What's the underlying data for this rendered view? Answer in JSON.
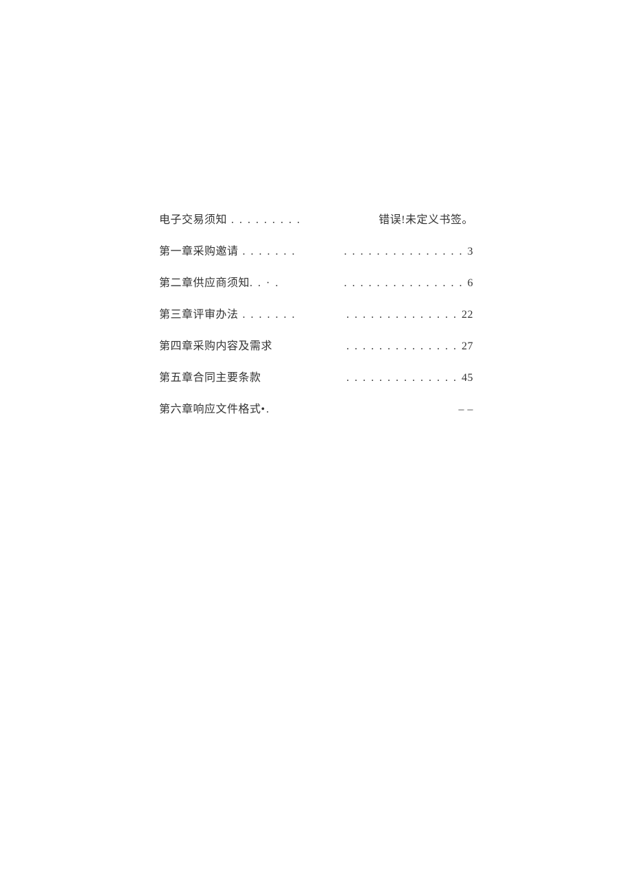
{
  "toc": {
    "rows": [
      {
        "left": "电子交易须知",
        "left_dots": " . . . . . . . . .",
        "right_dots": "",
        "right": "错误!未定义书签。"
      },
      {
        "left": "第一章采购邀请",
        "left_dots": " . . . . . . .",
        "right_dots": ". . . . . . . . . . . . . . . ",
        "right": "3"
      },
      {
        "left": "第二章供应商须知",
        "left_dots": ". .  ·  .",
        "right_dots": ". . . . . . . . . . . . . . . ",
        "right": "6"
      },
      {
        "left": "第三章评审办法",
        "left_dots": " . . . . . . .",
        "right_dots": ". . . . . . . . . . . . . . ",
        "right": "22"
      },
      {
        "left": "第四章采购内容及需求",
        "left_dots": "",
        "right_dots": ". . . . . . . . . . . . . . ",
        "right": "27"
      },
      {
        "left": "第五章合同主要条款",
        "left_dots": "",
        "right_dots": ". . . . . . . . . . . . . . ",
        "right": "45"
      },
      {
        "left": "第六章响应文件格式",
        "left_dots": "•.",
        "right_dots": "",
        "right": "– –"
      }
    ]
  }
}
